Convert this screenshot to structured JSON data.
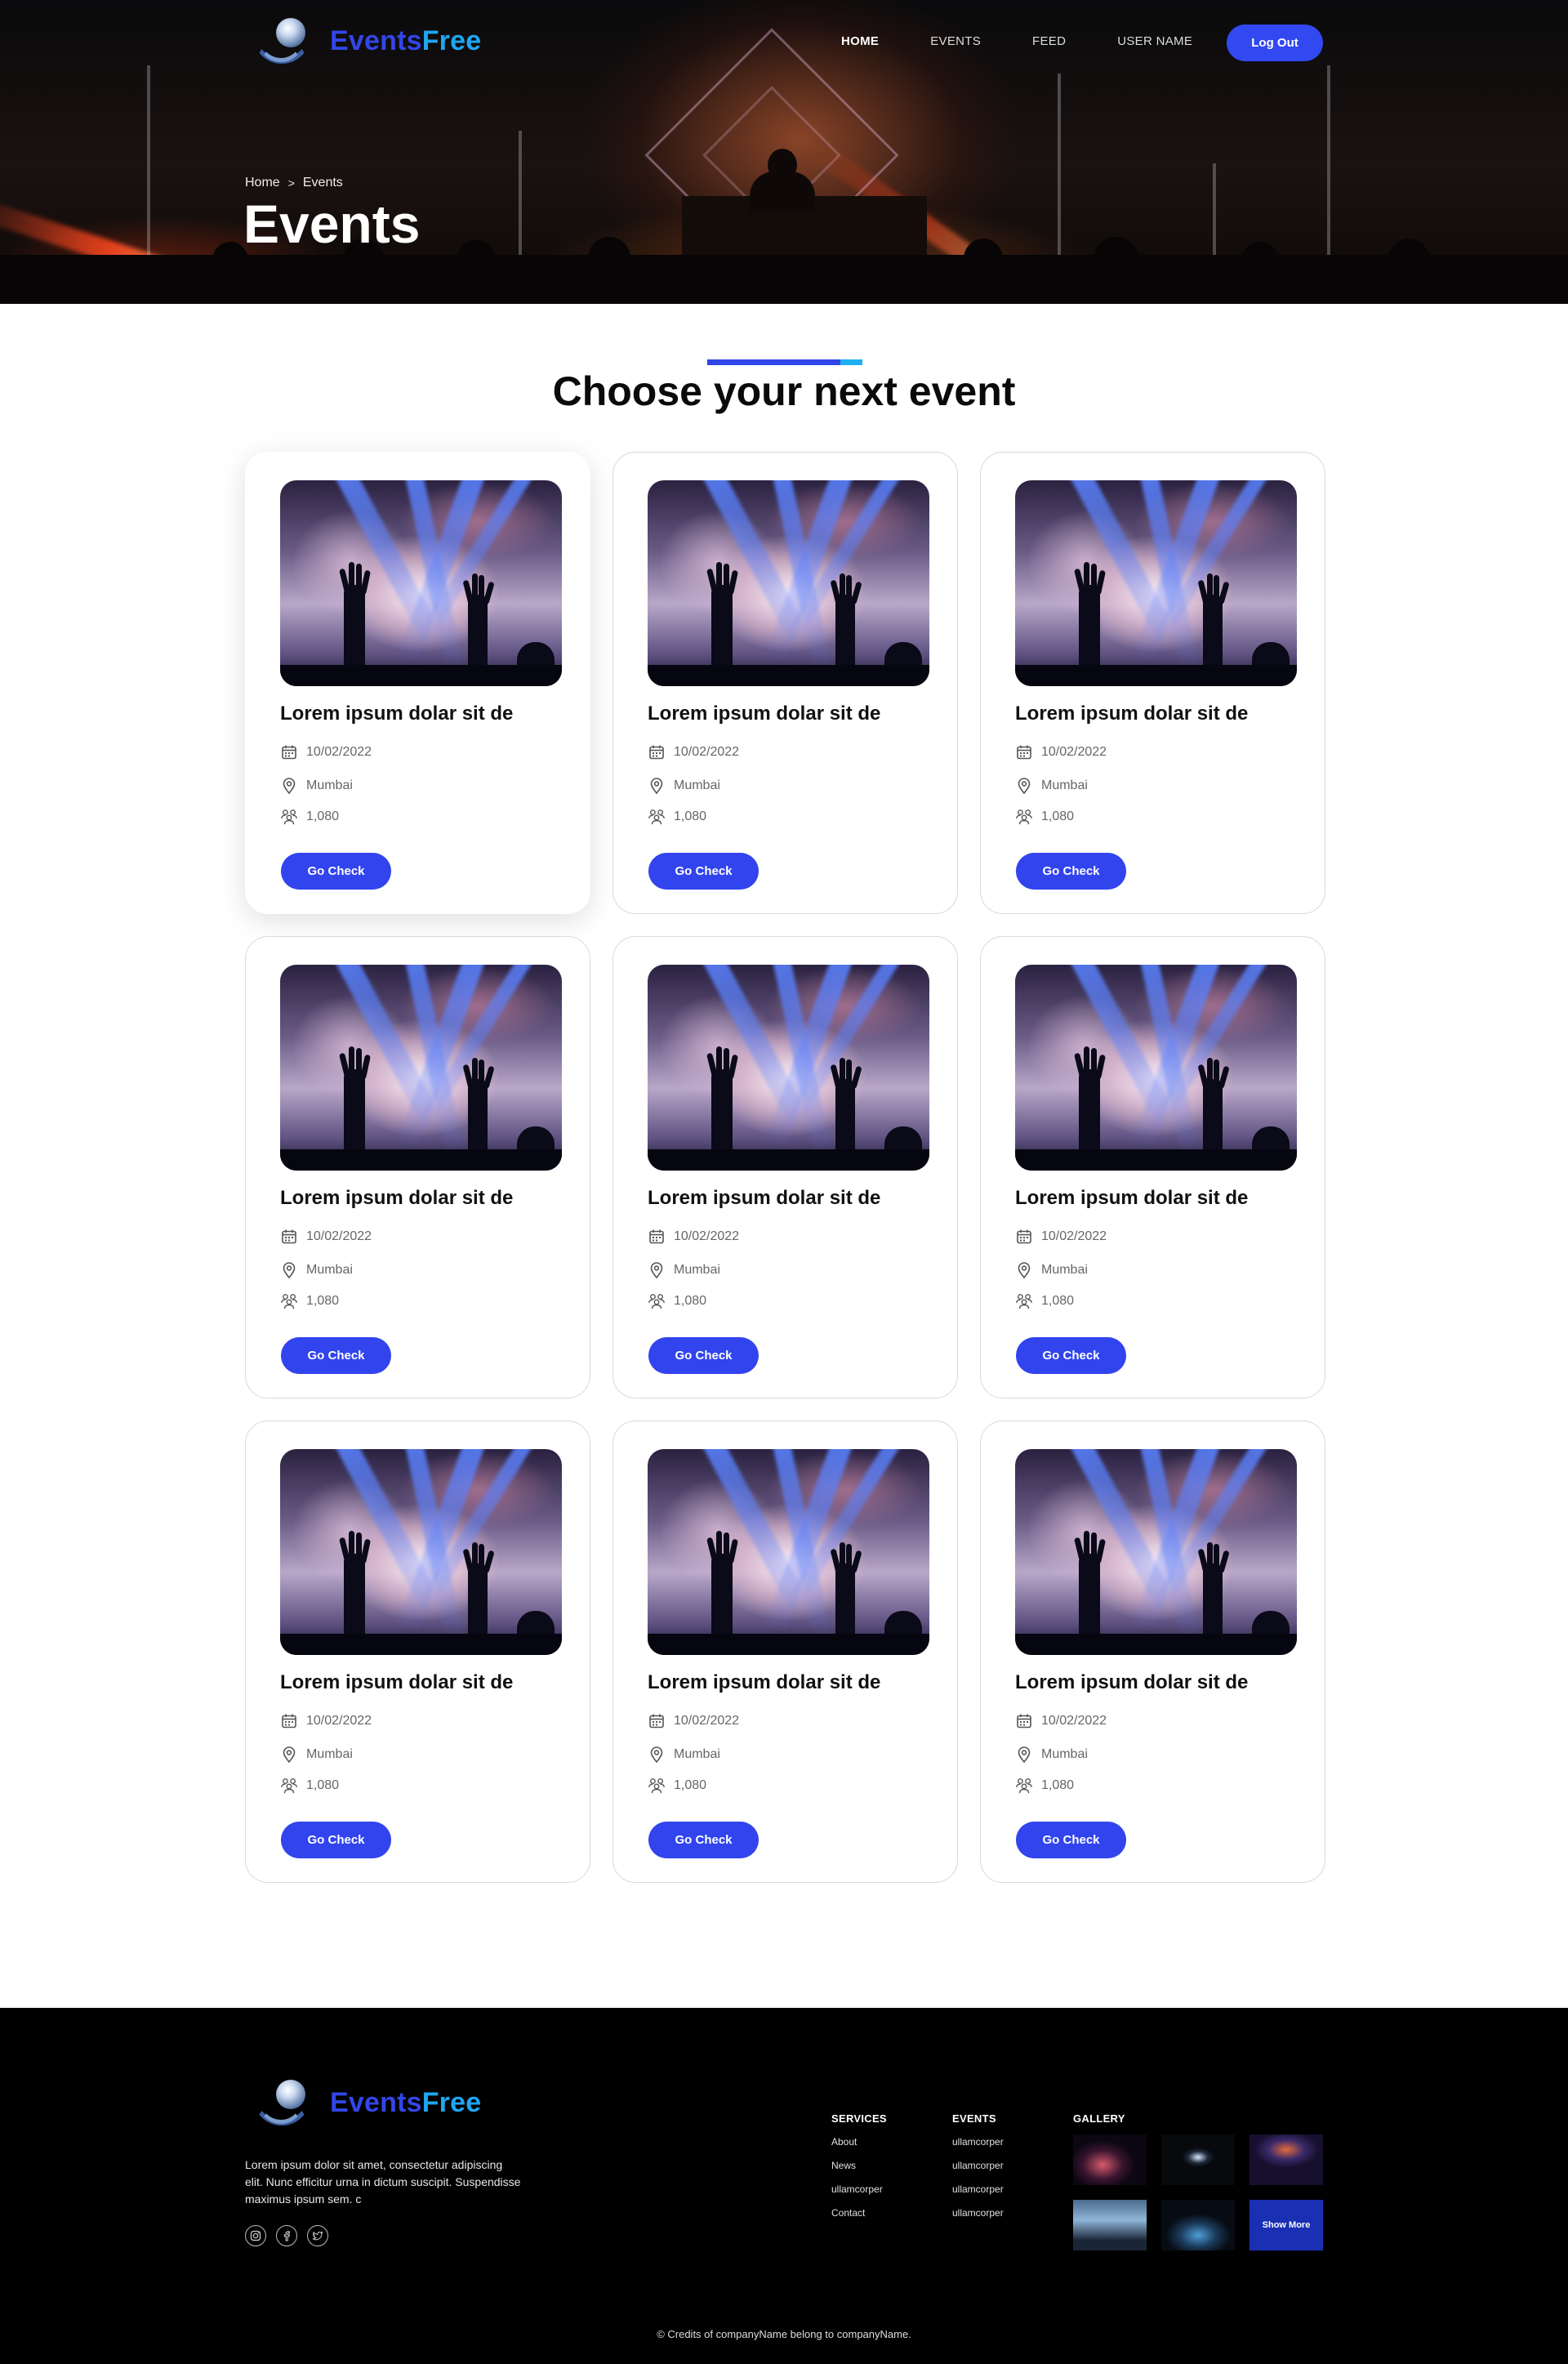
{
  "brand": {
    "name_part1": "Events",
    "name_part2": "Free"
  },
  "nav": {
    "links": [
      {
        "label": "HOME",
        "active": true
      },
      {
        "label": "EVENTS",
        "active": false
      },
      {
        "label": "FEED",
        "active": false
      },
      {
        "label": "USER NAME",
        "active": false
      }
    ],
    "logout_label": "Log Out"
  },
  "hero": {
    "breadcrumb": {
      "home": "Home",
      "separator": ">",
      "current": "Events"
    },
    "title": "Events"
  },
  "section": {
    "title": "Choose your next event"
  },
  "events": [
    {
      "title": "Lorem ipsum dolar sit de",
      "date": "10/02/2022",
      "location": "Mumbai",
      "attendees": "1,080",
      "button": "Go Check",
      "featured": true
    },
    {
      "title": "Lorem ipsum dolar sit de",
      "date": "10/02/2022",
      "location": "Mumbai",
      "attendees": "1,080",
      "button": "Go Check",
      "featured": false
    },
    {
      "title": "Lorem ipsum dolar sit de",
      "date": "10/02/2022",
      "location": "Mumbai",
      "attendees": "1,080",
      "button": "Go Check",
      "featured": false
    },
    {
      "title": "Lorem ipsum dolar sit de",
      "date": "10/02/2022",
      "location": "Mumbai",
      "attendees": "1,080",
      "button": "Go Check",
      "featured": false
    },
    {
      "title": "Lorem ipsum dolar sit de",
      "date": "10/02/2022",
      "location": "Mumbai",
      "attendees": "1,080",
      "button": "Go Check",
      "featured": false
    },
    {
      "title": "Lorem ipsum dolar sit de",
      "date": "10/02/2022",
      "location": "Mumbai",
      "attendees": "1,080",
      "button": "Go Check",
      "featured": false
    },
    {
      "title": "Lorem ipsum dolar sit de",
      "date": "10/02/2022",
      "location": "Mumbai",
      "attendees": "1,080",
      "button": "Go Check",
      "featured": false
    },
    {
      "title": "Lorem ipsum dolar sit de",
      "date": "10/02/2022",
      "location": "Mumbai",
      "attendees": "1,080",
      "button": "Go Check",
      "featured": false
    },
    {
      "title": "Lorem ipsum dolar sit de",
      "date": "10/02/2022",
      "location": "Mumbai",
      "attendees": "1,080",
      "button": "Go Check",
      "featured": false
    }
  ],
  "icons": {
    "date": "calendar-icon",
    "location": "map-pin-icon",
    "attendees": "people-icon"
  },
  "footer": {
    "description": "Lorem ipsum dolor sit amet, consectetur adipiscing elit. Nunc efficitur urna in dictum suscipit. Suspendisse maximus ipsum sem. c",
    "socials": [
      "instagram-icon",
      "facebook-icon",
      "twitter-icon"
    ],
    "services": {
      "heading": "SERVICES",
      "links": [
        "About",
        "News",
        "ullamcorper",
        "Contact"
      ]
    },
    "events": {
      "heading": "EVENTS",
      "links": [
        "ullamcorper",
        "ullamcorper",
        "ullamcorper",
        "ullamcorper"
      ]
    },
    "gallery": {
      "heading": "GALLERY",
      "show_more": "Show More"
    },
    "copyright": "© Credits of companyName belong to companyName."
  },
  "colors": {
    "primary": "#3144EE",
    "accent": "#1EA6F2",
    "footer_bg": "#000000"
  }
}
